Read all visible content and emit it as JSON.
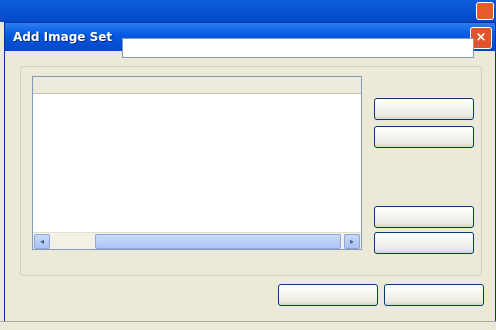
{
  "background_window": {
    "title": ""
  },
  "dialog": {
    "title": "Add Image Set",
    "close_glyph": "×",
    "name_label": "",
    "name_value": "",
    "group_label": "",
    "list": {
      "header": "",
      "rows": [
        "",
        "",
        "",
        "",
        ""
      ]
    },
    "buttons": {
      "side_1": "",
      "side_2": "",
      "side_3": "",
      "side_4": "",
      "ok": "",
      "cancel": ""
    }
  },
  "colors": {
    "titlebar": "#0558e2",
    "dialog_bg": "#ece9d8",
    "close_button": "#e1542b",
    "scroll_thumb": "#adc5f5"
  },
  "icons": {
    "close": "close-icon",
    "scroll_left": "scroll-left-arrow-icon",
    "scroll_right": "scroll-right-arrow-icon"
  }
}
